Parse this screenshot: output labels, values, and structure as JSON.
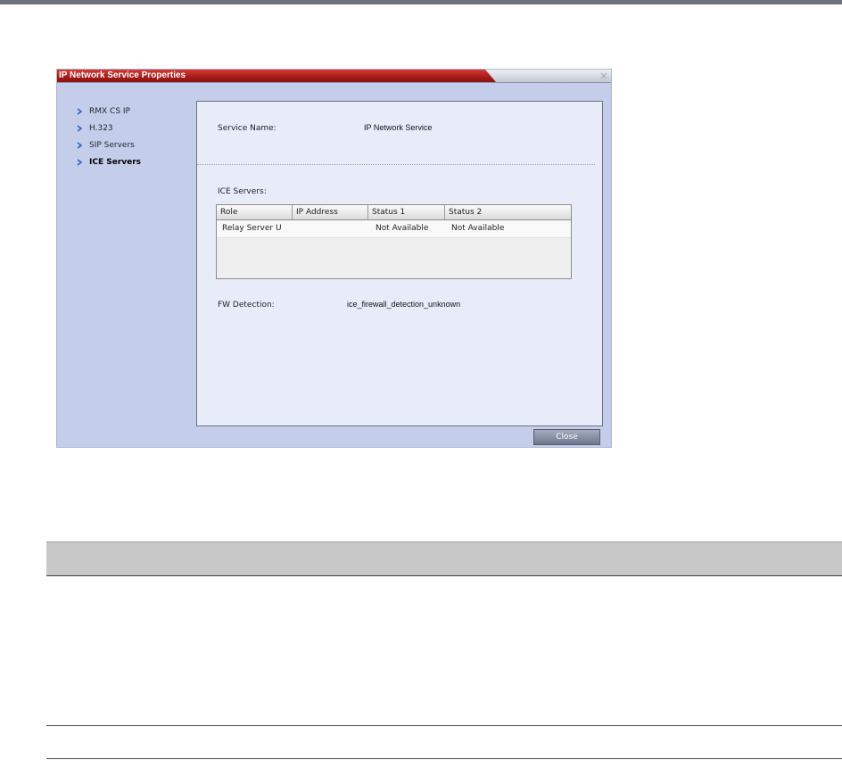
{
  "dialog": {
    "title": "IP Network Service Properties",
    "nav": [
      {
        "label": "RMX CS IP",
        "selected": false
      },
      {
        "label": "H.323",
        "selected": false
      },
      {
        "label": "SIP Servers",
        "selected": false
      },
      {
        "label": "ICE Servers",
        "selected": true
      }
    ],
    "service_name_label": "Service Name:",
    "service_name_value": "IP Network Service",
    "ice_servers_label": "ICE Servers:",
    "ice_table": {
      "columns": [
        "Role",
        "IP Address",
        "Status 1",
        "Status 2"
      ],
      "rows": [
        [
          "Relay Server U",
          "",
          "Not Available",
          "Not Available"
        ]
      ]
    },
    "fw_detection_label": "FW Detection:",
    "fw_detection_value": "ice_firewall_detection_unknown",
    "close_button_label": "Close"
  },
  "icons": {
    "title_close": "close-icon",
    "nav_arrow": "chevron-right-icon"
  },
  "colors": {
    "title_red": "#a61a1a",
    "dialog_bg": "#c4ceeb",
    "panel_bg": "#e8ecf9",
    "nav_arrow": "#2f63c4",
    "close_button": "#6f788d",
    "doc_header_band": "#c8c8c8"
  }
}
